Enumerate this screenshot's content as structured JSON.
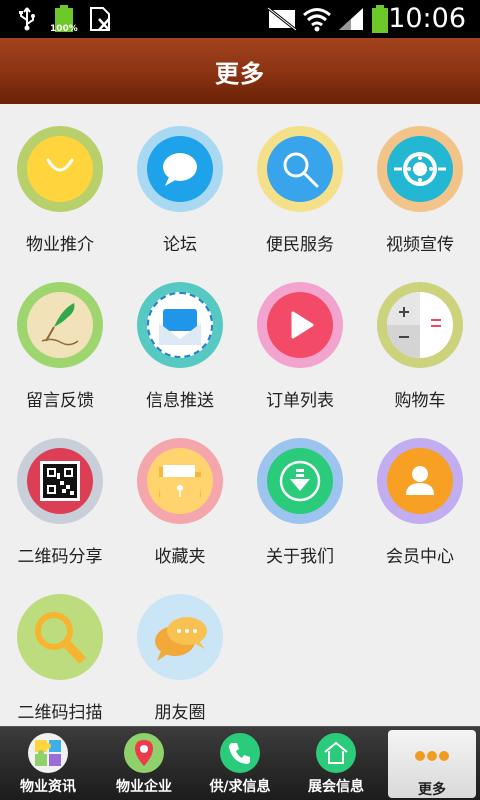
{
  "status_bar": {
    "battery_level": "100%",
    "time": "10:06"
  },
  "header": {
    "title": "更多"
  },
  "grid": {
    "items": [
      {
        "label": "物业推介",
        "icon": "shopping-bag-icon",
        "ring": "#b7d06b",
        "disc": "#ffd43d"
      },
      {
        "label": "论坛",
        "icon": "chat-bubble-icon",
        "ring": "#a9d8f3",
        "disc": "#1ea2ea"
      },
      {
        "label": "便民服务",
        "icon": "search-icon",
        "ring": "#f5e08a",
        "disc": "#38a4ec"
      },
      {
        "label": "视频宣传",
        "icon": "film-reel-icon",
        "ring": "#f3c48a",
        "disc": "#23b7d3"
      },
      {
        "label": "留言反馈",
        "icon": "quill-pen-icon",
        "ring": "#9fd56f",
        "disc": "#f1e2ba"
      },
      {
        "label": "信息推送",
        "icon": "envelope-icon",
        "ring": "#56c9c2",
        "disc": "#ffffff"
      },
      {
        "label": "订单列表",
        "icon": "play-icon",
        "ring": "#f2a3ce",
        "disc": "#f34a67"
      },
      {
        "label": "购物车",
        "icon": "calculator-icon",
        "ring": "#cdd27c",
        "disc": "#ffffff"
      },
      {
        "label": "二维码分享",
        "icon": "qr-code-icon",
        "ring": "#c9cfd8",
        "disc": "#dc3f55"
      },
      {
        "label": "收藏夹",
        "icon": "folder-icon",
        "ring": "#f5a6ad",
        "disc": "#ffd36e"
      },
      {
        "label": "关于我们",
        "icon": "download-icon",
        "ring": "#9cc4ef",
        "disc": "#2bcb7c"
      },
      {
        "label": "会员中心",
        "icon": "user-profile-icon",
        "ring": "#c1adef",
        "disc": "#f7a024"
      },
      {
        "label": "二维码扫描",
        "icon": "magnifier-icon",
        "ring": "#bcdc7d",
        "disc": "#bcdc7d"
      },
      {
        "label": "朋友圈",
        "icon": "speech-bubbles-icon",
        "ring": "#c9e5f6",
        "disc": "#c9e5f6"
      }
    ]
  },
  "bottom_nav": {
    "items": [
      {
        "label": "物业资讯",
        "icon": "puzzle-icon",
        "color": "#ffd43d"
      },
      {
        "label": "物业企业",
        "icon": "map-pin-icon",
        "color": "#8fd16a"
      },
      {
        "label": "供/求信息",
        "icon": "phone-icon",
        "color": "#2bcb7c"
      },
      {
        "label": "展会信息",
        "icon": "house-icon",
        "color": "#2bcb7c"
      },
      {
        "label": "更多",
        "icon": "more-dots-icon",
        "color": "#f29c1f"
      }
    ]
  }
}
